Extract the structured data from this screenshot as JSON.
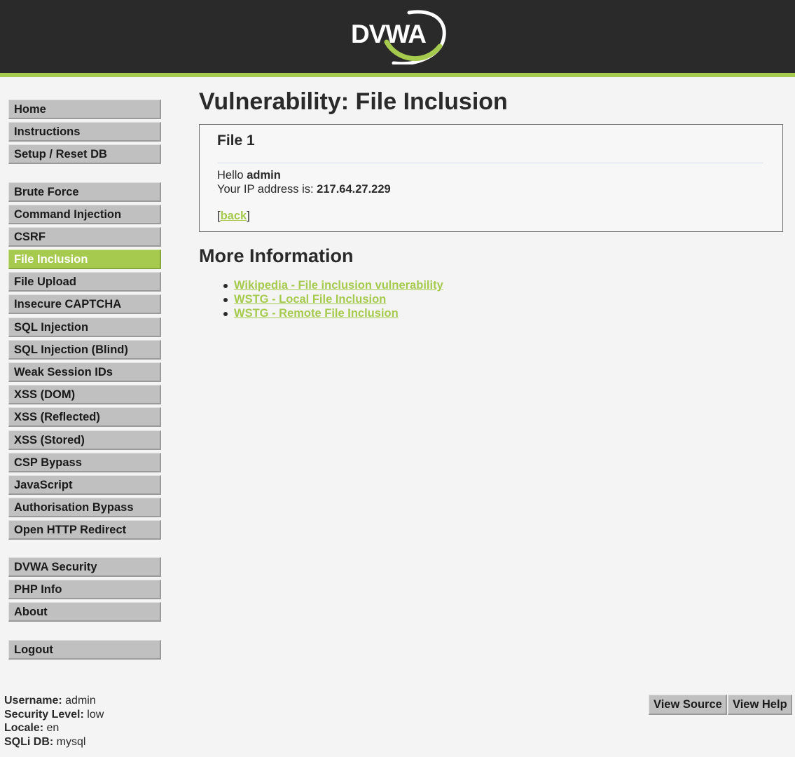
{
  "header": {
    "logo_text": "DVWA",
    "accent_color": "#a6ca4d",
    "background_color": "#2a2a2a"
  },
  "sidebar": {
    "group1": [
      {
        "label": "Home"
      },
      {
        "label": "Instructions"
      },
      {
        "label": "Setup / Reset DB"
      }
    ],
    "group2": [
      {
        "label": "Brute Force"
      },
      {
        "label": "Command Injection"
      },
      {
        "label": "CSRF"
      },
      {
        "label": "File Inclusion",
        "selected": true
      },
      {
        "label": "File Upload"
      },
      {
        "label": "Insecure CAPTCHA"
      },
      {
        "label": "SQL Injection"
      },
      {
        "label": "SQL Injection (Blind)"
      },
      {
        "label": "Weak Session IDs"
      },
      {
        "label": "XSS (DOM)"
      },
      {
        "label": "XSS (Reflected)"
      },
      {
        "label": "XSS (Stored)"
      },
      {
        "label": "CSP Bypass"
      },
      {
        "label": "JavaScript"
      },
      {
        "label": "Authorisation Bypass"
      },
      {
        "label": "Open HTTP Redirect"
      }
    ],
    "group3": [
      {
        "label": "DVWA Security"
      },
      {
        "label": "PHP Info"
      },
      {
        "label": "About"
      }
    ],
    "group4": [
      {
        "label": "Logout"
      }
    ]
  },
  "main": {
    "title": "Vulnerability: File Inclusion",
    "file_box": {
      "heading": "File 1",
      "hello_prefix": "Hello ",
      "username": "admin",
      "ip_prefix": "Your IP address is: ",
      "ip_address": "217.64.27.229",
      "back_open": "[",
      "back_label": "back",
      "back_close": "]"
    },
    "more_info": {
      "heading": "More Information",
      "links": [
        "Wikipedia - File inclusion vulnerability",
        "WSTG - Local File Inclusion",
        "WSTG - Remote File Inclusion"
      ]
    }
  },
  "footer": {
    "username_label": "Username:",
    "username_value": "admin",
    "security_label": "Security Level:",
    "security_value": "low",
    "locale_label": "Locale:",
    "locale_value": "en",
    "sqli_label": "SQLi DB:",
    "sqli_value": "mysql",
    "view_source_label": "View Source",
    "view_help_label": "View Help"
  }
}
